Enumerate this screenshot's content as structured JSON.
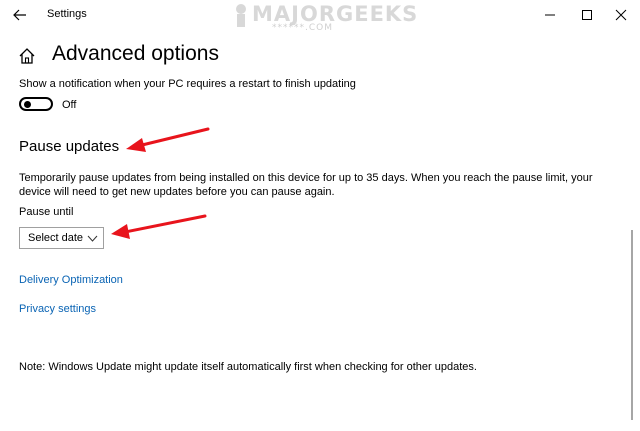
{
  "window": {
    "title": "Settings"
  },
  "watermark": {
    "text": "MAJORGEEKS",
    "sub": "******.COM"
  },
  "page": {
    "title": "Advanced options"
  },
  "notification": {
    "label": "Show a notification when your PC requires a restart to finish updating",
    "toggle_state": "Off"
  },
  "pause": {
    "heading": "Pause updates",
    "description": "Temporarily pause updates from being installed on this device for up to 35 days. When you reach the pause limit, your device will need to get new updates before you can pause again.",
    "until_label": "Pause until",
    "select_value": "Select date"
  },
  "links": {
    "delivery": "Delivery Optimization",
    "privacy": "Privacy settings"
  },
  "note": "Note: Windows Update might update itself automatically first when checking for other updates.",
  "colors": {
    "link": "#0a64b4",
    "arrow": "#e8141c"
  }
}
